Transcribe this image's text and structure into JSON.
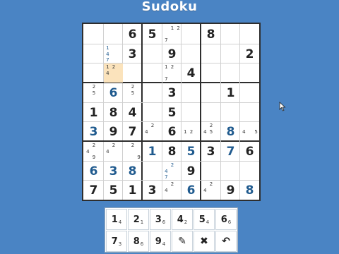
{
  "title": "Sudoku",
  "board": {
    "highlight": [
      2,
      1
    ],
    "cells": [
      [
        {
          "pm": []
        },
        {
          "pm": []
        },
        {
          "v": "6"
        },
        {
          "v": "5"
        },
        {
          "pm": [
            "",
            "1",
            "2",
            "",
            "",
            "",
            "7",
            "",
            ""
          ]
        },
        {
          "pm": []
        },
        {
          "v": "8"
        },
        {
          "pm": []
        },
        {
          "pm": []
        }
      ],
      [
        {
          "pm": []
        },
        {
          "pm": [
            "1",
            "",
            "",
            "4",
            "",
            "",
            "7",
            "",
            ""
          ],
          "pmc": "blue"
        },
        {
          "v": "3"
        },
        {
          "pm": []
        },
        {
          "v": "9"
        },
        {
          "pm": []
        },
        {
          "pm": []
        },
        {
          "pm": []
        },
        {
          "v": "2"
        }
      ],
      [
        {
          "pm": []
        },
        {
          "pm": [
            "1",
            "2",
            "",
            "4",
            "",
            "",
            "",
            "",
            ""
          ]
        },
        {
          "pm": []
        },
        {
          "pm": []
        },
        {
          "pm": [
            "1",
            "2",
            "",
            "",
            "",
            "",
            "7",
            "",
            ""
          ]
        },
        {
          "v": "4"
        },
        {
          "pm": []
        },
        {
          "pm": []
        },
        {
          "pm": []
        }
      ],
      [
        {
          "pm": [
            "",
            "2",
            "",
            "",
            "5",
            "",
            "",
            "",
            ""
          ]
        },
        {
          "v": "6",
          "u": true
        },
        {
          "pm": [
            "",
            "2",
            "",
            "",
            "5",
            "",
            "",
            "",
            ""
          ]
        },
        {
          "pm": []
        },
        {
          "v": "3"
        },
        {
          "pm": []
        },
        {
          "pm": []
        },
        {
          "v": "1"
        },
        {
          "pm": []
        }
      ],
      [
        {
          "v": "1"
        },
        {
          "v": "8"
        },
        {
          "v": "4"
        },
        {
          "pm": []
        },
        {
          "v": "5"
        },
        {
          "pm": []
        },
        {
          "pm": []
        },
        {
          "pm": []
        },
        {
          "pm": []
        }
      ],
      [
        {
          "v": "3",
          "u": true
        },
        {
          "v": "9"
        },
        {
          "v": "7"
        },
        {
          "pm": [
            "",
            "2",
            "",
            "4",
            "",
            "",
            "",
            "",
            ""
          ]
        },
        {
          "v": "6"
        },
        {
          "pm": [
            "",
            "",
            "",
            "1",
            "2",
            "",
            "",
            "",
            ""
          ]
        },
        {
          "pm": [
            "",
            "2",
            "",
            "4",
            "5",
            "",
            "",
            "",
            ""
          ]
        },
        {
          "v": "8",
          "u": true
        },
        {
          "pm": [
            "",
            "",
            "",
            "4",
            "",
            "5",
            "",
            "",
            ""
          ]
        }
      ],
      [
        {
          "pm": [
            "",
            "2",
            "",
            "4",
            "",
            "",
            "",
            "9",
            ""
          ]
        },
        {
          "pm": [
            "",
            "2",
            "",
            "4",
            "",
            "",
            "",
            "",
            ""
          ]
        },
        {
          "pm": [
            "",
            "2",
            "",
            "",
            "",
            "",
            "",
            "",
            "9"
          ]
        },
        {
          "v": "1",
          "u": true
        },
        {
          "v": "8"
        },
        {
          "v": "5",
          "u": true
        },
        {
          "v": "3"
        },
        {
          "v": "7",
          "u": true
        },
        {
          "v": "6"
        }
      ],
      [
        {
          "v": "6",
          "u": true
        },
        {
          "v": "3",
          "u": true
        },
        {
          "v": "8",
          "u": true
        },
        {
          "pm": []
        },
        {
          "pm": [
            "",
            "2",
            "",
            "4",
            "",
            "",
            "7",
            "",
            ""
          ],
          "pmc": "blue"
        },
        {
          "v": "9"
        },
        {
          "pm": []
        },
        {
          "pm": []
        },
        {
          "pm": []
        }
      ],
      [
        {
          "v": "7"
        },
        {
          "v": "5"
        },
        {
          "v": "1"
        },
        {
          "v": "3"
        },
        {
          "pm": [
            "",
            "2",
            "",
            "4",
            "",
            "",
            "",
            "",
            ""
          ]
        },
        {
          "v": "6",
          "u": true
        },
        {
          "pm": [
            "",
            "2",
            "",
            "4",
            "",
            "",
            "",
            "",
            ""
          ]
        },
        {
          "v": "9"
        },
        {
          "v": "8",
          "u": true
        }
      ]
    ]
  },
  "keypad": {
    "row1": [
      {
        "n": "1",
        "c": "4"
      },
      {
        "n": "2",
        "c": "1"
      },
      {
        "n": "3",
        "c": "6"
      },
      {
        "n": "4",
        "c": "2"
      },
      {
        "n": "5",
        "c": "4"
      },
      {
        "n": "6",
        "c": "6"
      }
    ],
    "row2": [
      {
        "n": "7",
        "c": "3"
      },
      {
        "n": "8",
        "c": "6"
      },
      {
        "n": "9",
        "c": "4"
      },
      {
        "icon": "pencil-icon",
        "glyph": "✎"
      },
      {
        "icon": "erase-icon",
        "glyph": "✖"
      },
      {
        "icon": "undo-icon",
        "glyph": "↶"
      }
    ]
  }
}
